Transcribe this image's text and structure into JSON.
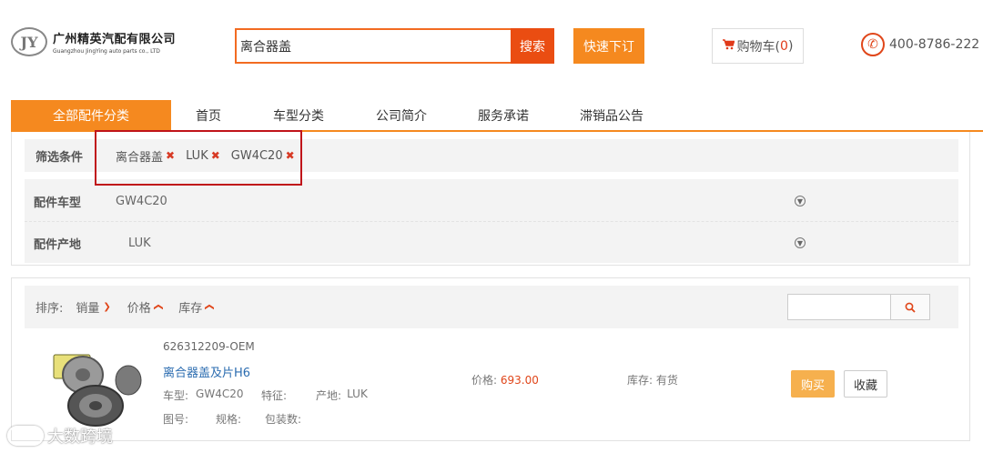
{
  "header": {
    "logo_cn": "广州精英汽配有限公司",
    "logo_en": "Guangzhou JingYing auto parts co., LTD",
    "search_value": "离合器盖",
    "search_button": "搜索",
    "quick_order": "快速下订",
    "cart_label": "购物车(",
    "cart_count": "0",
    "cart_close": ")",
    "phone": "400-8786-222"
  },
  "nav": {
    "all": "全部配件分类",
    "items": [
      "首页",
      "车型分类",
      "公司简介",
      "服务承诺",
      "滞销品公告"
    ]
  },
  "filter": {
    "label": "筛选条件",
    "chips": [
      "离合器盖",
      "LUK",
      "GW4C20"
    ],
    "rows": [
      {
        "label": "配件车型",
        "value": "GW4C20"
      },
      {
        "label": "配件产地",
        "value": "LUK"
      }
    ]
  },
  "sort": {
    "label": "排序:",
    "items": [
      "销量",
      "价格",
      "库存"
    ]
  },
  "product": {
    "oem": "626312209-OEM",
    "name": "离合器盖及片H6",
    "model_label": "车型:",
    "model_value": "GW4C20",
    "feature_label": "特征:",
    "origin_label": "产地:",
    "origin_value": "LUK",
    "figure_label": "图号:",
    "spec_label": "规格:",
    "pack_label": "包装数:",
    "price_label": "价格:",
    "price_value": "693.00",
    "stock": "库存: 有货",
    "buy": "购买",
    "fav": "收藏"
  },
  "watermark": "大数跨境",
  "colors": {
    "accent": "#f5891f",
    "search_red": "#ea4d12",
    "highlight": "#c0141a"
  }
}
